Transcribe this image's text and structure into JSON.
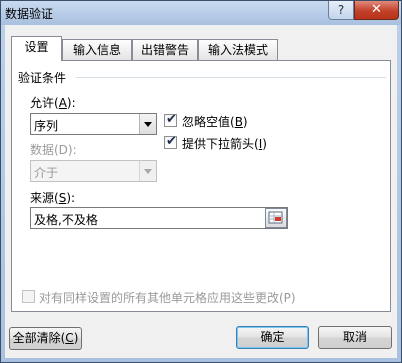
{
  "window": {
    "title": "数据验证",
    "help_label": "?",
    "close_label": "✕"
  },
  "tabs": [
    {
      "label": "设置",
      "active": true
    },
    {
      "label": "输入信息",
      "active": false
    },
    {
      "label": "出错警告",
      "active": false
    },
    {
      "label": "输入法模式",
      "active": false
    }
  ],
  "settings": {
    "group_label": "验证条件",
    "allow": {
      "label_prefix": "允许(",
      "label_key": "A",
      "label_suffix": "):",
      "value": "序列"
    },
    "data": {
      "label": "数据(D):",
      "value": "介于"
    },
    "ignore_blank": {
      "label_prefix": "忽略空值(",
      "label_key": "B",
      "label_suffix": ")",
      "checked": true
    },
    "dropdown": {
      "label_prefix": "提供下拉箭头(",
      "label_key": "I",
      "label_suffix": ")",
      "checked": true
    },
    "source": {
      "label_prefix": "来源(",
      "label_key": "S",
      "label_suffix": "):",
      "value": "及格,不及格"
    },
    "apply_all": {
      "label": "对有同样设置的所有其他单元格应用这些更改(P)",
      "checked": false
    }
  },
  "footer": {
    "clear_prefix": "全部清除(",
    "clear_key": "C",
    "clear_suffix": ")",
    "ok_label": "确定",
    "cancel_label": "取消"
  }
}
